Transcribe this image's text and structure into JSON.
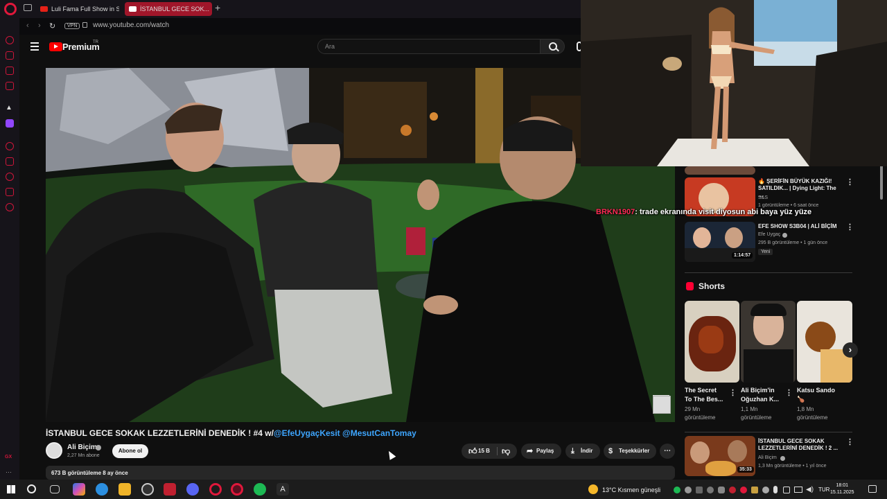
{
  "browser": {
    "tabs": [
      {
        "label": "Luli Fama Full Show in SL..."
      },
      {
        "label": "İSTANBUL GECE SOK..."
      }
    ],
    "new_tab": "+",
    "vpn_label": "VPN",
    "url": "www.youtube.com/watch"
  },
  "youtube": {
    "logo_text": "Premium",
    "logo_region": "TR",
    "search_placeholder": "Ara"
  },
  "video": {
    "title_main": "İSTANBUL GECE SOKAK LEZZETLERİNİ DENEDİK ! #4 w/",
    "title_links": "@EfeUygaçKesit @MesutCanTomay",
    "channel": "Ali Biçim",
    "subscribers": "2,27 Mn abone",
    "subscribe_label": "Abone ol",
    "likes": "15 B",
    "share_label": "Paylaş",
    "download_label": "İndir",
    "thanks_label": "Teşekkürler",
    "more": "⋯",
    "description_meta": "673 B görüntüleme  8 ay önce"
  },
  "chat_overlay": {
    "user": "BRKN1907",
    "message": ": trade ekranında visit diyosun abi baya yüz yüze"
  },
  "recommended": [
    {
      "title_line1": "🔥 ŞERİFİN BÜYÜK KAZIĞI!",
      "title_line2": "SATILDIK... | Dying Light: The ...",
      "channel": "S&S",
      "meta": "1 görüntüleme • 6 saat önce",
      "duration": ""
    },
    {
      "title_line1": "EFE SHOW S3B04 | ALİ BİÇİM",
      "title_line2": "",
      "channel": "Efe Uygaç",
      "meta": "295 B görüntüleme • 1 gün önce",
      "badge": "Yeni",
      "duration": "1:14:57"
    },
    {
      "title_line1": "İSTANBUL GECE SOKAK",
      "title_line2": "LEZZETLERİNİ DENEDİK ! 2 ...",
      "channel": "Ali Biçim",
      "meta": "1,3 Mn görüntüleme • 1 yıl önce",
      "duration": "35:33"
    }
  ],
  "shorts": {
    "heading": "Shorts",
    "items": [
      {
        "title1": "The Secret",
        "title2": "To The Bes...",
        "views1": "29 Mn",
        "views2": "görüntüleme"
      },
      {
        "title1": "Ali Biçim'in",
        "title2": "Oğuzhan K...",
        "views1": "1,1 Mn",
        "views2": "görüntüleme"
      },
      {
        "title1": "Katsu Sando",
        "title2": "🍗",
        "views1": "1,8 Mn",
        "views2": "görüntüleme"
      }
    ],
    "next": "›"
  },
  "taskbar": {
    "weather": "13°C  Kısmen güneşli",
    "lang": "TUR",
    "time": "18:01",
    "date": "15.11.2025"
  },
  "colors": {
    "accent": "#ff0000",
    "opera": "#e0183b",
    "link": "#3ea6ff"
  }
}
